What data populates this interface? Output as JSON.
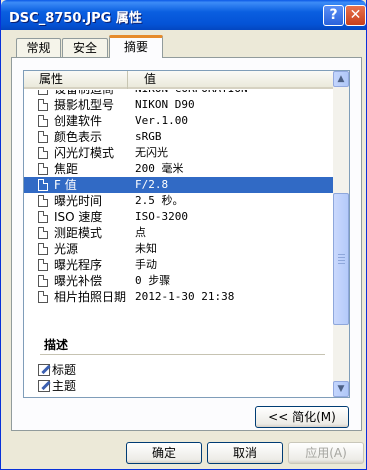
{
  "window": {
    "title": "DSC_8750.JPG 属性",
    "help_glyph": "?",
    "close_glyph": "✕"
  },
  "tabs": [
    {
      "label": "常规"
    },
    {
      "label": "安全"
    },
    {
      "label": "摘要",
      "active": true
    }
  ],
  "list": {
    "columns": {
      "property": "属性",
      "value": "值"
    },
    "rows": [
      {
        "property": "设备制造商",
        "value": "NIKON CORPORATION",
        "partial": true
      },
      {
        "property": "摄影机型号",
        "value": "NIKON D90"
      },
      {
        "property": "创建软件",
        "value": "Ver.1.00"
      },
      {
        "property": "颜色表示",
        "value": "sRGB"
      },
      {
        "property": "闪光灯模式",
        "value": "无闪光"
      },
      {
        "property": "焦距",
        "value": "200 毫米"
      },
      {
        "property": "F 值",
        "value": "F/2.8",
        "selected": true
      },
      {
        "property": "曝光时间",
        "value": "2.5 秒。"
      },
      {
        "property": "ISO 速度",
        "value": "ISO-3200"
      },
      {
        "property": "测距模式",
        "value": "点"
      },
      {
        "property": "光源",
        "value": "未知"
      },
      {
        "property": "曝光程序",
        "value": "手动"
      },
      {
        "property": "曝光补偿",
        "value": "0 步骤"
      },
      {
        "property": "相片拍照日期",
        "value": "2012-1-30 21:38"
      }
    ],
    "section": {
      "title": "描述",
      "items": [
        {
          "label": "标题"
        },
        {
          "label": "主题"
        }
      ]
    },
    "scroll_up_glyph": "▲",
    "scroll_down_glyph": "▼"
  },
  "buttons": {
    "simplify": "<< 简化(M)",
    "ok": "确定",
    "cancel": "取消",
    "apply": "应用(A)"
  },
  "colors": {
    "title_bar": "#0a5fe0",
    "selection": "#316ac5",
    "active_tab_accent": "#e68b2c"
  }
}
